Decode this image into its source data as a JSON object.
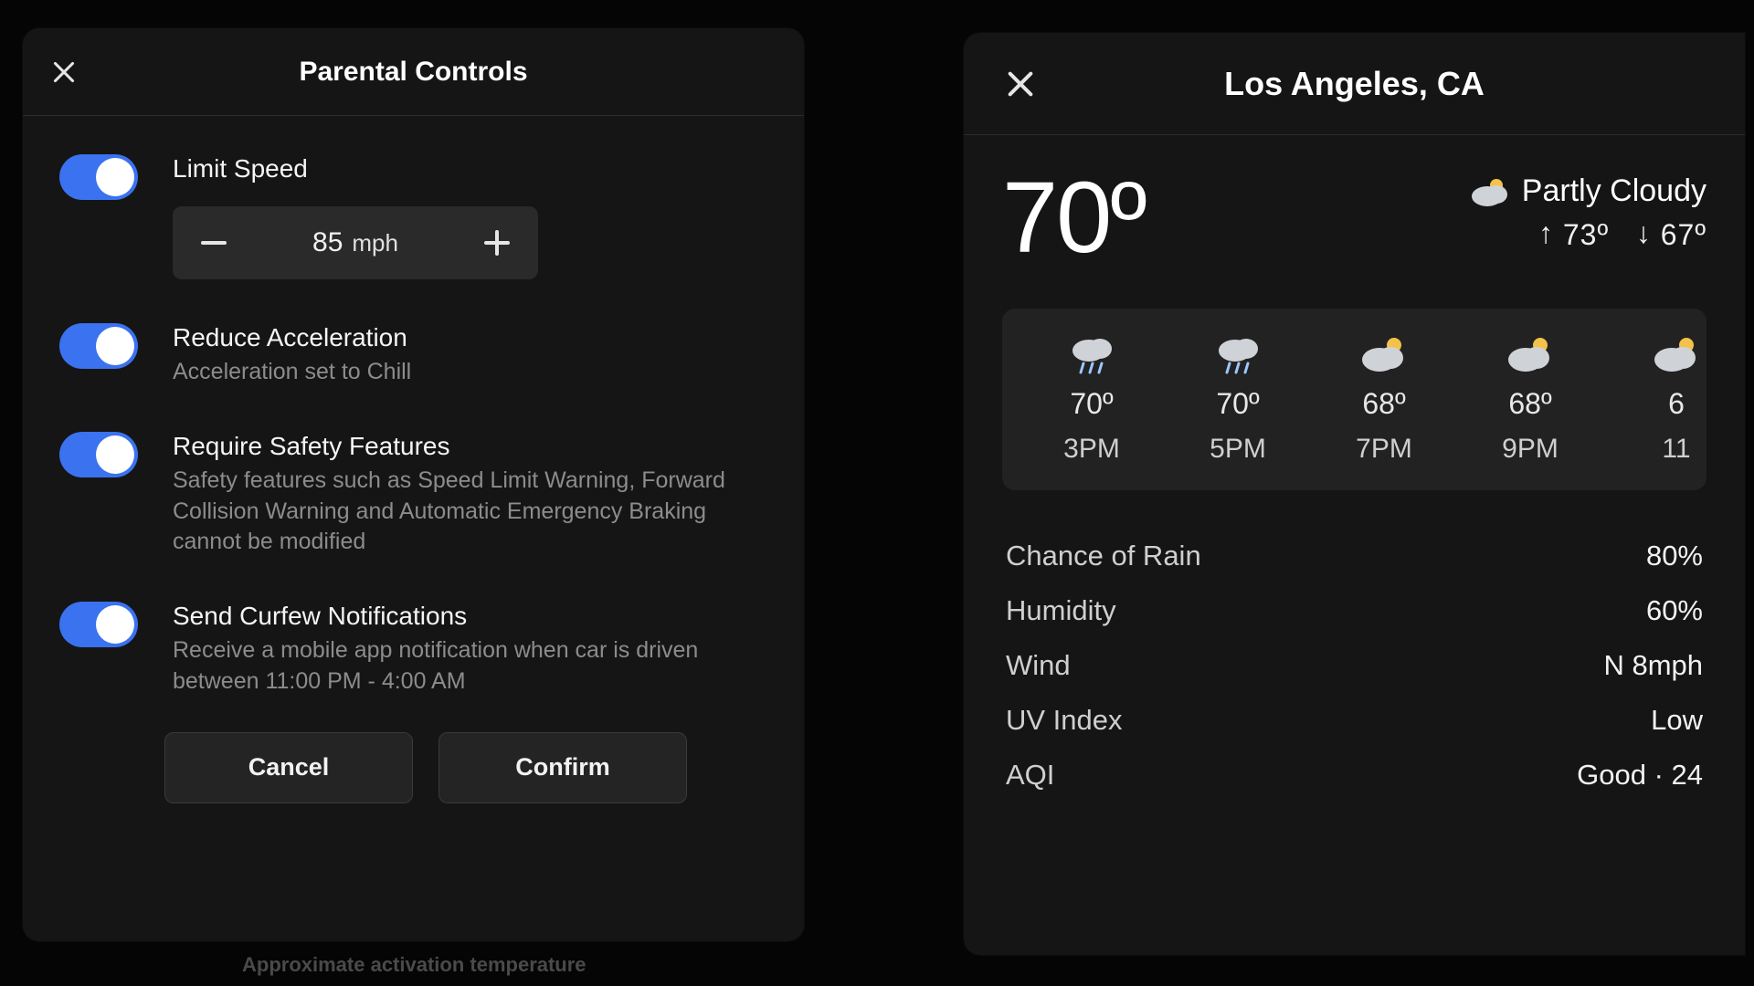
{
  "footer_caption": "Approximate activation temperature",
  "parental": {
    "title": "Parental Controls",
    "limit_speed": {
      "label": "Limit Speed",
      "value": "85",
      "unit": "mph"
    },
    "reduce_accel": {
      "label": "Reduce Acceleration",
      "desc": "Acceleration set to Chill"
    },
    "safety": {
      "label": "Require Safety Features",
      "desc": "Safety features such as Speed Limit Warning, Forward Collision Warning and Automatic Emergency Braking cannot be modified"
    },
    "curfew": {
      "label": "Send Curfew Notifications",
      "desc": "Receive a mobile app notification when car is driven between 11:00 PM - 4:00 AM"
    },
    "cancel": "Cancel",
    "confirm": "Confirm"
  },
  "weather": {
    "location": "Los Angeles, CA",
    "current_temp": "70º",
    "condition": "Partly Cloudy",
    "high": "73º",
    "low": "67º",
    "forecast": [
      {
        "temp": "70º",
        "time": "3PM",
        "icon": "rain"
      },
      {
        "temp": "70º",
        "time": "5PM",
        "icon": "rain"
      },
      {
        "temp": "68º",
        "time": "7PM",
        "icon": "partly"
      },
      {
        "temp": "68º",
        "time": "9PM",
        "icon": "partly"
      },
      {
        "temp": "6",
        "time": "11",
        "icon": "partly"
      }
    ],
    "stats": {
      "rain_k": "Chance of Rain",
      "rain_v": "80%",
      "hum_k": "Humidity",
      "hum_v": "60%",
      "wind_k": "Wind",
      "wind_v": "N 8mph",
      "uv_k": "UV Index",
      "uv_v": "Low",
      "aqi_k": "AQI",
      "aqi_v": "Good · 24"
    }
  }
}
